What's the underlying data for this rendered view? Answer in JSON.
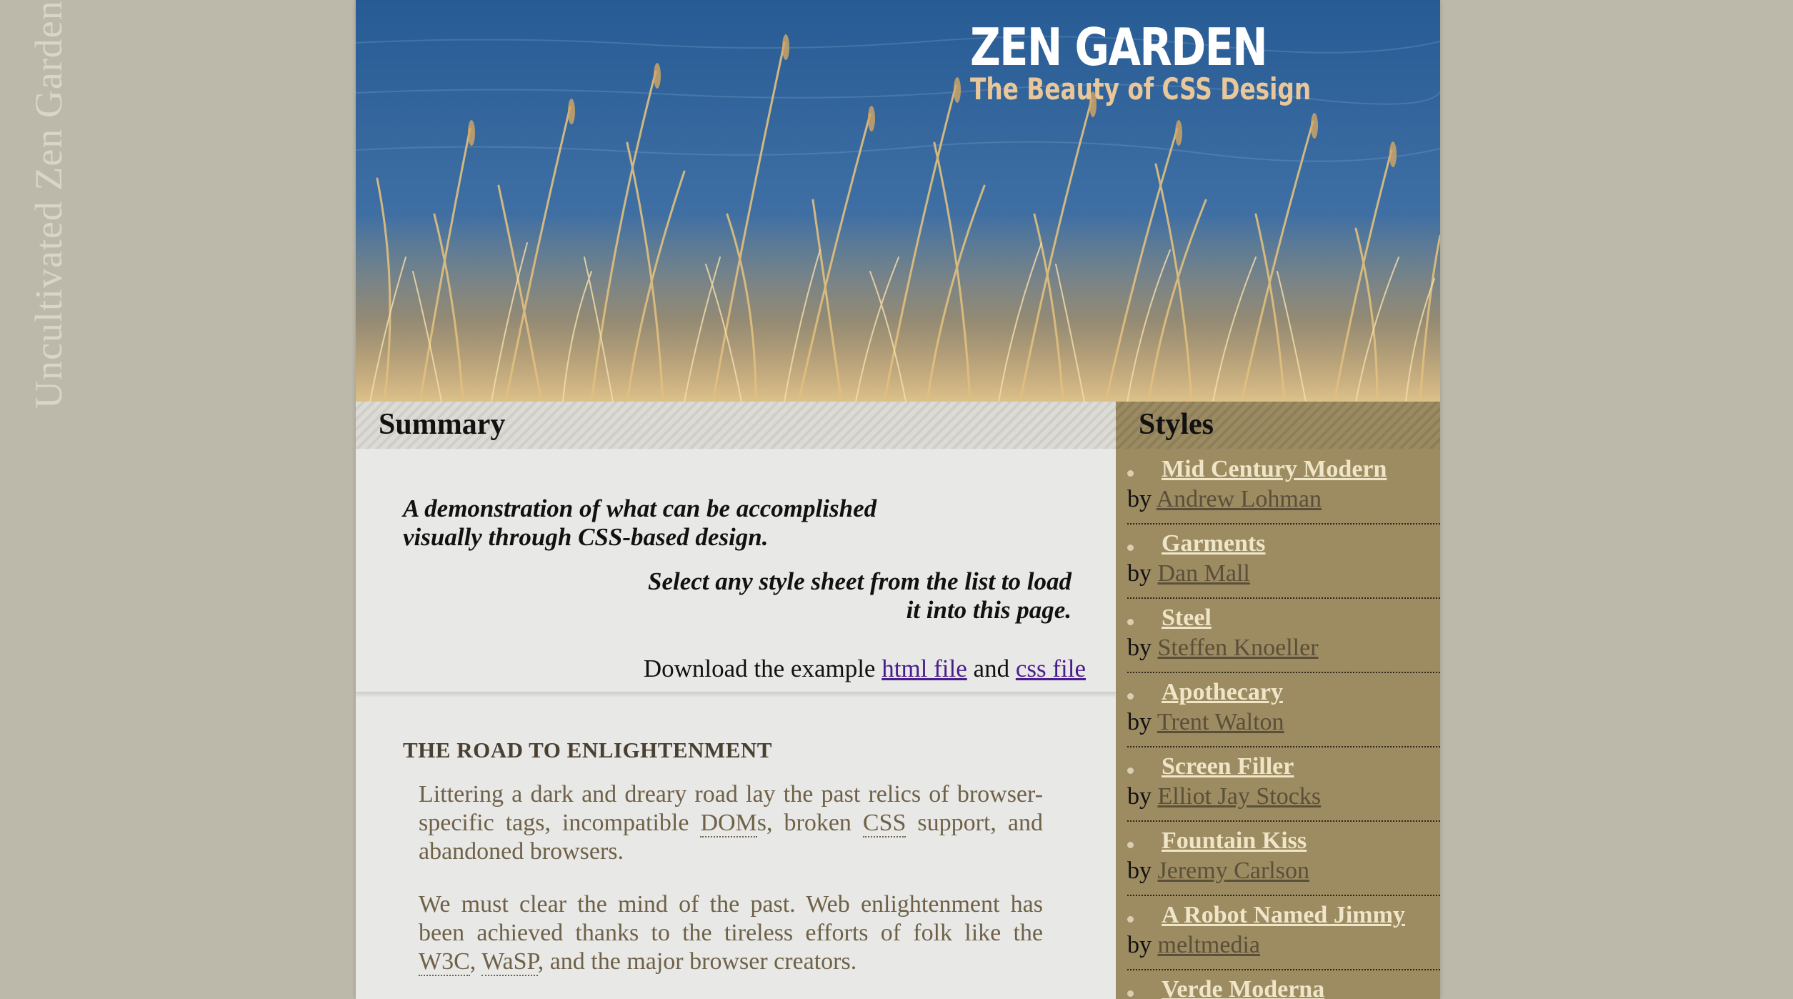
{
  "side_title": "Uncultivated Zen Garden",
  "header": {
    "title": "ZEN GARDEN",
    "subtitle": "The Beauty of CSS Design"
  },
  "summary": {
    "heading": "Summary",
    "intro_line1": "A demonstration of what can be accomplished visually through CSS-based design.",
    "intro_line2": "Select any style sheet from the list to load it into this page.",
    "download_prefix": "Download the example",
    "html_link": "html file",
    "and": "and",
    "css_link": "css file"
  },
  "road": {
    "heading": "THE ROAD TO ENLIGHTENMENT",
    "p1_a": "Littering a dark and dreary road lay the past relics of browser-specific tags, incompatible ",
    "p1_dom": "DOM",
    "p1_b": "s, broken ",
    "p1_css": "CSS",
    "p1_c": " support, and abandoned browsers.",
    "p2_a": "We must clear the mind of the past. Web enlightenment has been achieved thanks to the tireless efforts of folk like the ",
    "p2_w3c": "W3C",
    "p2_sep": ", ",
    "p2_wasp": "WaSP",
    "p2_b": ", and the major browser creators."
  },
  "styles": {
    "heading": "Styles",
    "by_label": "by",
    "items": [
      {
        "name": "Mid Century Modern",
        "author": "Andrew Lohman"
      },
      {
        "name": "Garments",
        "author": "Dan Mall"
      },
      {
        "name": "Steel",
        "author": "Steffen Knoeller"
      },
      {
        "name": "Apothecary",
        "author": "Trent Walton"
      },
      {
        "name": "Screen Filler",
        "author": "Elliot Jay Stocks"
      },
      {
        "name": "Fountain Kiss",
        "author": "Jeremy Carlson"
      },
      {
        "name": "A Robot Named Jimmy",
        "author": "meltmedia"
      },
      {
        "name": "Verde Moderna",
        "author": ""
      }
    ]
  },
  "colors": {
    "background": "#bcb9aa",
    "styles_panel": "#9d8b62",
    "link_visited": "#4a1d8c",
    "body_text": "#6f6148"
  }
}
